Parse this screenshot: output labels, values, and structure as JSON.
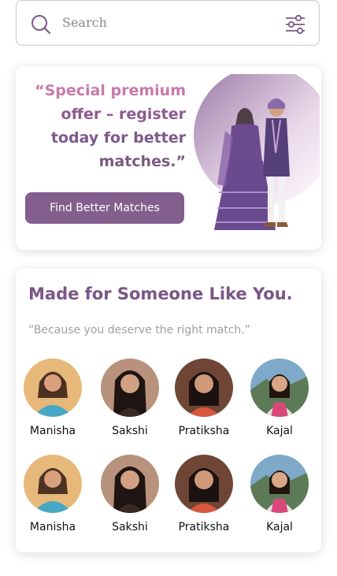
{
  "search": {
    "placeholder": "Search"
  },
  "offer": {
    "line1": "“Special premium",
    "line2": "offer – register",
    "line3": "today for better",
    "line4": "matches.”",
    "button_label": "Find Better Matches"
  },
  "made": {
    "title": "Made for Someone Like You.",
    "tagline": "“Because you deserve the right match.”",
    "profiles": [
      {
        "name": "Manisha"
      },
      {
        "name": "Sakshi"
      },
      {
        "name": "Pratiksha"
      },
      {
        "name": "Kajal"
      },
      {
        "name": "Manisha"
      },
      {
        "name": "Sakshi"
      },
      {
        "name": "Pratiksha"
      },
      {
        "name": "Kajal"
      }
    ]
  },
  "colors": {
    "brand": "#835f8d",
    "headline_pink": "#c77aa9",
    "headline_purple": "#7a5a7e"
  },
  "icons": [
    "search-icon",
    "filter-icon"
  ]
}
